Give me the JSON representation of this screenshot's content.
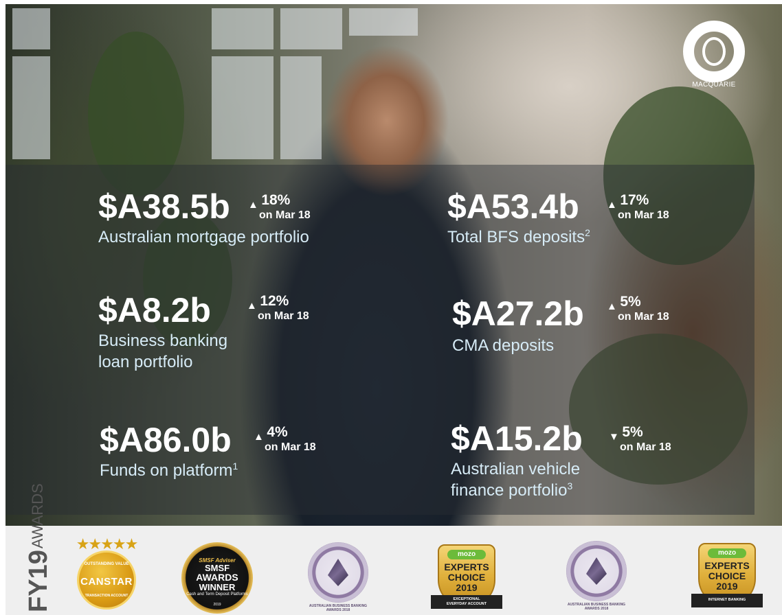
{
  "logo": {
    "wordmark": "MACQUARIE"
  },
  "stats": [
    {
      "value": "$A38.5b",
      "arrow": "▲",
      "change": "18%",
      "period": "on Mar 18",
      "label_lines": [
        "Australian mortgage portfolio"
      ],
      "footnote": ""
    },
    {
      "value": "$A53.4b",
      "arrow": "▲",
      "change": "17%",
      "period": "on Mar 18",
      "label_lines": [
        "Total BFS deposits"
      ],
      "footnote": "2"
    },
    {
      "value": "$A8.2b",
      "arrow": "▲",
      "change": "12%",
      "period": "on Mar 18",
      "label_lines": [
        "Business banking",
        "loan portfolio"
      ],
      "footnote": ""
    },
    {
      "value": "$A27.2b",
      "arrow": "▲",
      "change": "5%",
      "period": "on Mar 18",
      "label_lines": [
        "CMA deposits"
      ],
      "footnote": ""
    },
    {
      "value": "$A86.0b",
      "arrow": "▲",
      "change": "4%",
      "period": "on Mar 18",
      "label_lines": [
        "Funds on platform"
      ],
      "footnote": "1"
    },
    {
      "value": "$A15.2b",
      "arrow": "▼",
      "change": "5%",
      "period": "on Mar 18",
      "label_lines": [
        "Australian vehicle",
        "finance portfolio"
      ],
      "footnote": "3"
    }
  ],
  "awards_heading": {
    "year": "FY19",
    "word": "AWARDS"
  },
  "awards": {
    "canstar": {
      "stars": "★★★★★",
      "top": "OUTSTANDING VALUE",
      "name": "CANSTAR",
      "bottom": "TRANSACTION ACCOUNT"
    },
    "smsf": {
      "line1": "SMSF Adviser",
      "line2": "SMSF",
      "line3": "AWARDS",
      "line4": "WINNER",
      "line5": "Cash and Term Deposit Platforms",
      "line6": "2019"
    },
    "seal1": {
      "caption_1": "AUSTRALIAN BUSINESS BANKING",
      "caption_2": "AWARDS 2018"
    },
    "mozo1": {
      "brand": "mozo",
      "l1": "EXPERTS",
      "l2": "CHOICE",
      "l3": "2019",
      "ribbon_1": "EXCEPTIONAL",
      "ribbon_2": "EVERYDAY ACCOUNT"
    },
    "seal2": {
      "caption_1": "AUSTRALIAN BUSINESS BANKING",
      "caption_2": "AWARDS 2018"
    },
    "mozo2": {
      "brand": "mozo",
      "l1": "EXPERTS",
      "l2": "CHOICE",
      "l3": "2019",
      "ribbon_1": "INTERNET BANKING"
    }
  }
}
